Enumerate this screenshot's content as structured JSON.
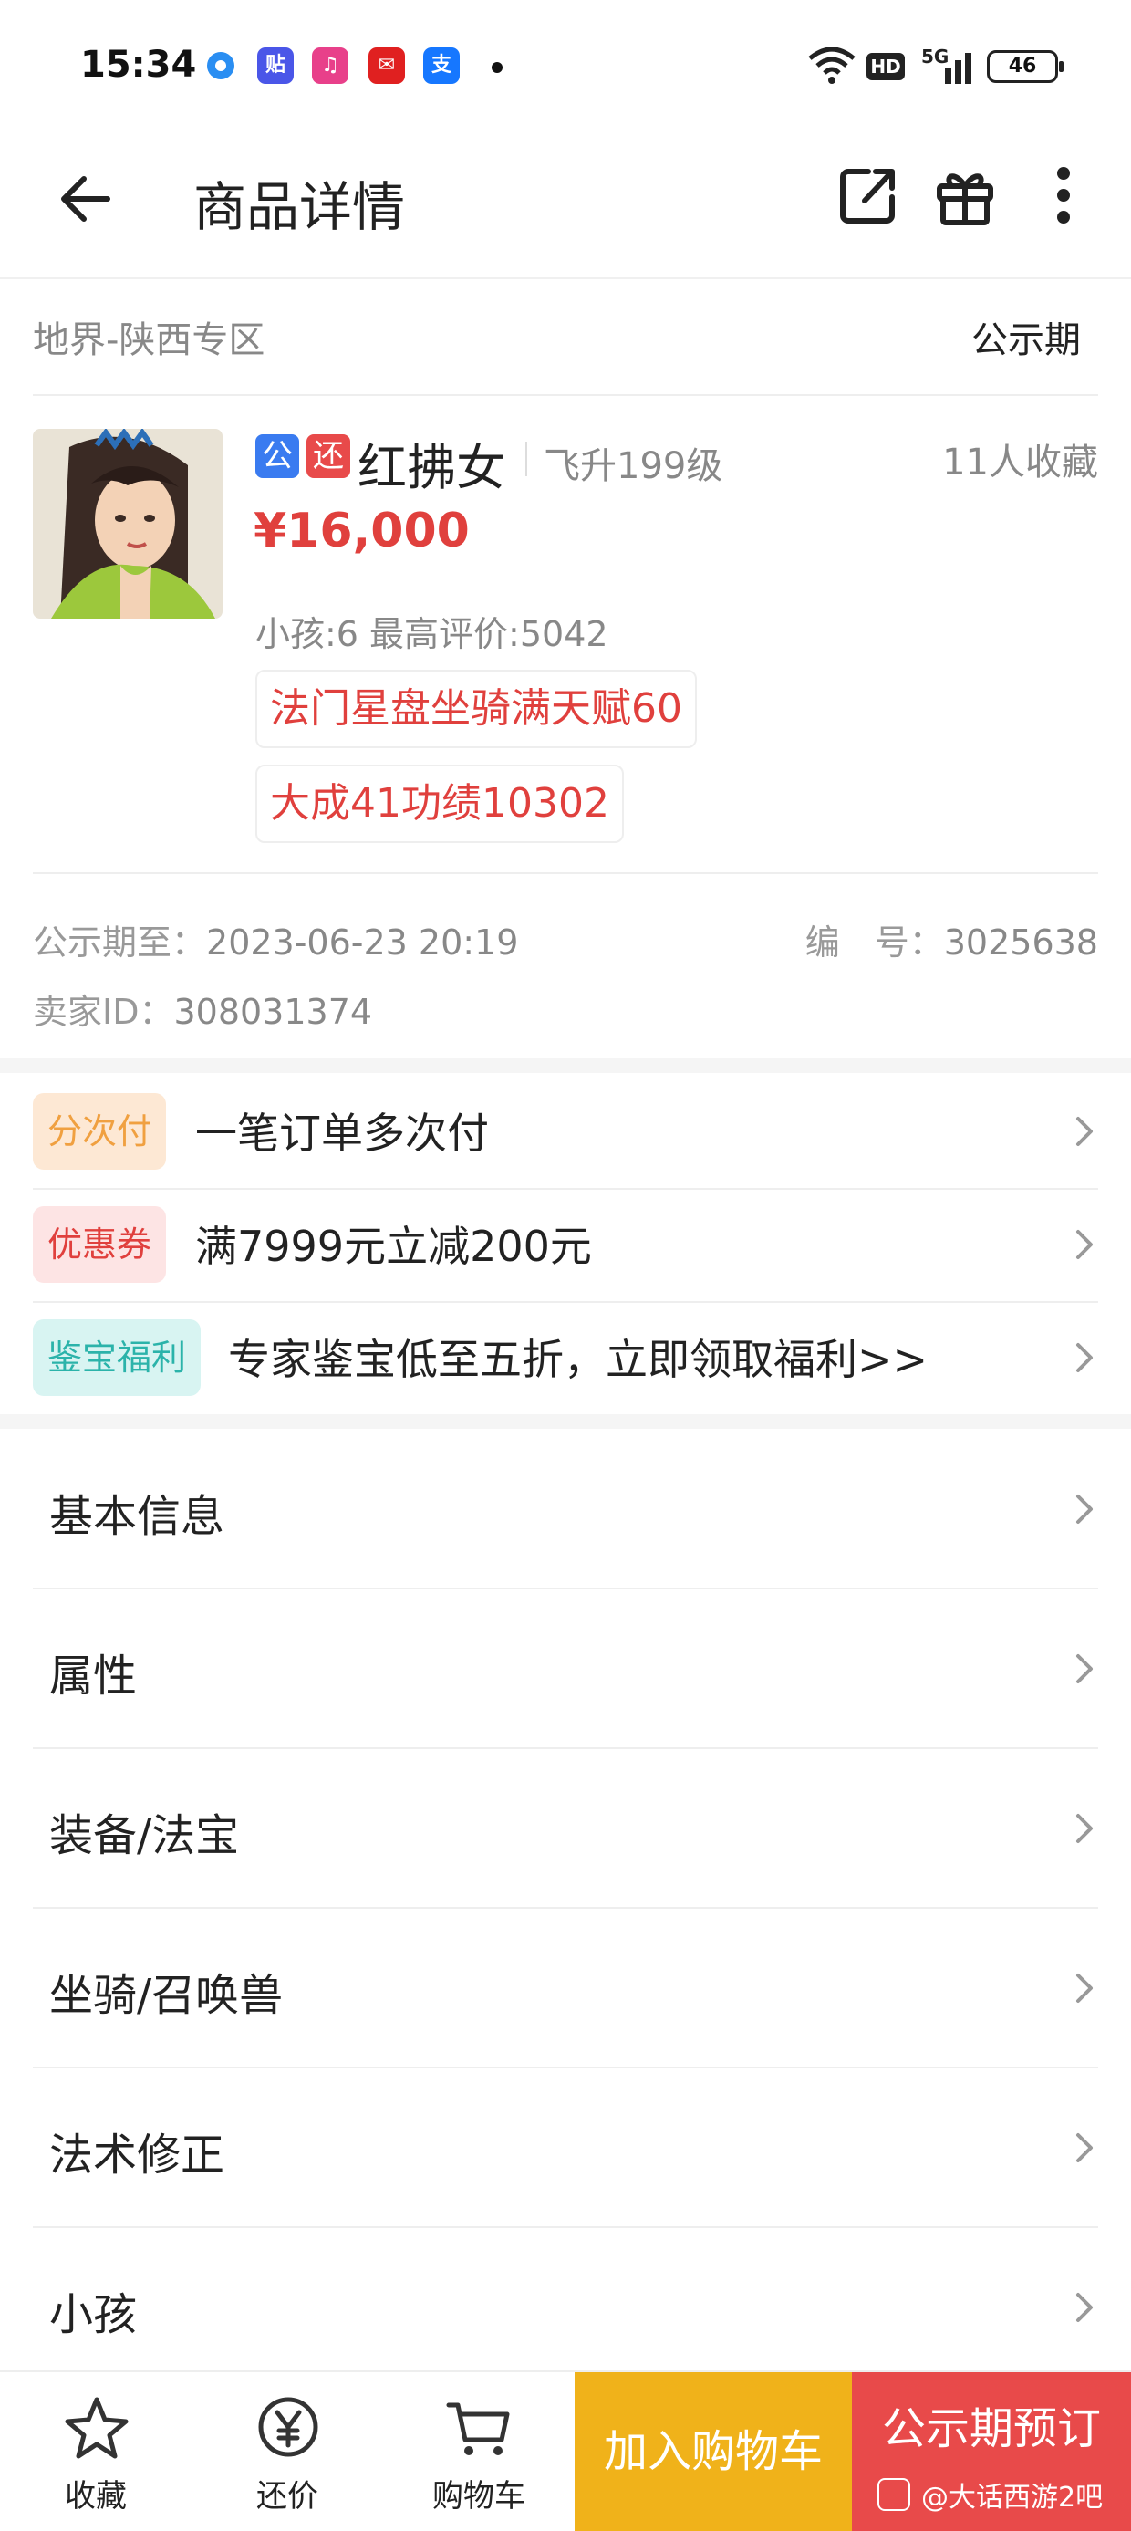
{
  "status_bar": {
    "time": "15:34",
    "battery": "46",
    "network": "5G",
    "hd": "HD"
  },
  "header": {
    "title": "商品详情"
  },
  "product": {
    "zone": "地界-陕西专区",
    "status": "公示期",
    "badge_public": "公",
    "badge_return": "还",
    "name": "红拂女",
    "level": "飞升199级",
    "favorites": "11人收藏",
    "price": "¥16,000",
    "info": "小孩:6 最高评价:5042",
    "tags": [
      "法门星盘坐骑满天赋60",
      "大成41功绩10302"
    ],
    "public_until_label": "公示期至：",
    "public_until": "2023-06-23 20:19",
    "number_label": "编　号：",
    "number": "3025638",
    "seller_label": "卖家ID：",
    "seller_id": "308031374"
  },
  "promotions": [
    {
      "badge": "分次付",
      "text": "一笔订单多次付",
      "badge_bg": "#fde8d4",
      "badge_color": "#f0a040"
    },
    {
      "badge": "优惠券",
      "text": "满7999元立减200元",
      "badge_bg": "#fde4e4",
      "badge_color": "#e0403d"
    },
    {
      "badge": "鉴宝福利",
      "text": "专家鉴宝低至五折，立即领取福利>>",
      "badge_bg": "#d8f4f2",
      "badge_color": "#2bb3aa"
    }
  ],
  "menu": [
    "基本信息",
    "属性",
    "装备/法宝",
    "坐骑/召唤兽",
    "法术修正",
    "小孩"
  ],
  "bottom_bar": {
    "favorite": "收藏",
    "bargain": "还价",
    "cart": "购物车",
    "add_to_cart": "加入购物车",
    "preorder": "公示期预订",
    "watermark": "@大话西游2吧"
  },
  "colors": {
    "accent_red": "#e0403d",
    "add_to_cart_bg": "#f0b21a",
    "preorder_bg": "#e84a4a",
    "badge_blue": "#3a7bf0"
  }
}
